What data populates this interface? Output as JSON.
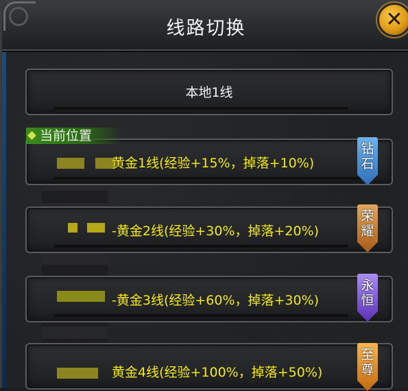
{
  "window": {
    "title": "线路切换",
    "close_icon": "✕"
  },
  "local_line": {
    "label": "本地1线"
  },
  "current_position": {
    "label": "当前位置"
  },
  "lines": [
    {
      "label": "黄金1线(经验+15%，掉落+10%)",
      "badge": "钻石",
      "badge_color": "#4b8fd6",
      "current": true
    },
    {
      "label": "-黄金2线(经验+30%，掉落+20%)",
      "badge": "荣耀",
      "badge_color": "#c0792a",
      "current": false
    },
    {
      "label": "-黄金3线(经验+60%，掉落+30%)",
      "badge": "永恒",
      "badge_color": "#7a4fd0",
      "current": false
    },
    {
      "label": "黄金4线(经验+100%，掉落+50%)",
      "badge": "至尊",
      "badge_color": "#e08a20",
      "current": false
    }
  ],
  "colors": {
    "gold_text": "#f3e91e",
    "tag_green": "#3a8a1e",
    "close_orange": "#e09a16"
  }
}
